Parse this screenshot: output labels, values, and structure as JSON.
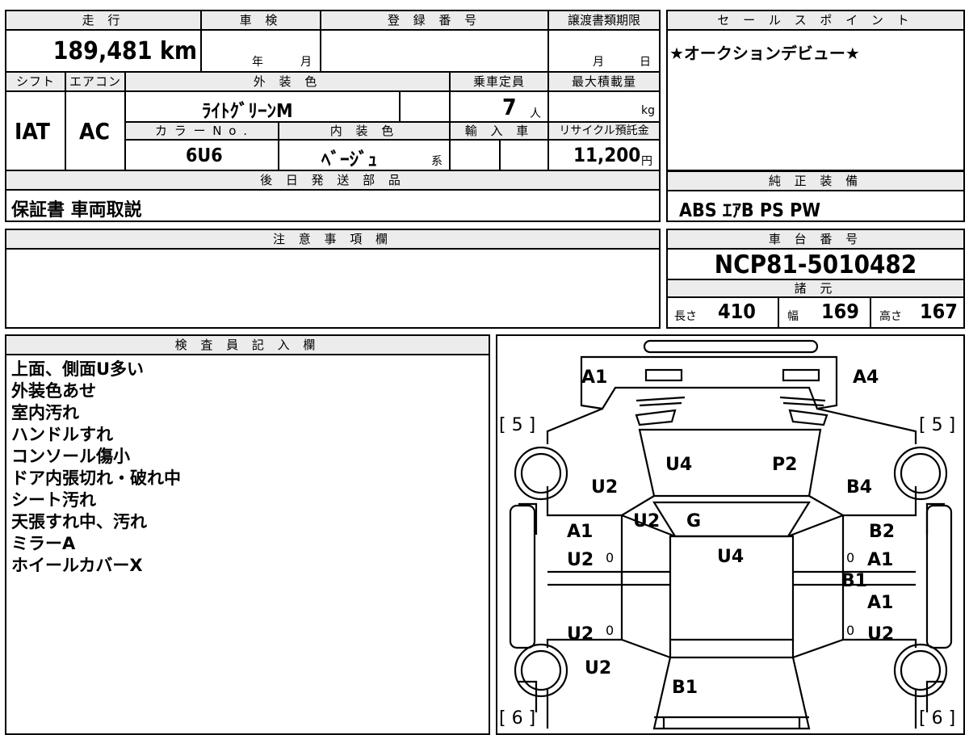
{
  "top_sheet": {
    "mileage_header": "走 行",
    "mileage": "189,481 km",
    "inspection_header": "車 検",
    "inspection_year_unit": "年",
    "inspection_month_unit": "月",
    "registration_header": "登 録 番 号",
    "transfer_header": "譲渡書類期限",
    "transfer_month_unit": "月",
    "transfer_day_unit": "日",
    "shift_header": "シフト",
    "shift": "IAT",
    "ac_header": "エアコン",
    "ac": "AC",
    "exterior_color_header": "外 装 色",
    "exterior_color": "ﾗｲﾄｸﾞﾘｰﾝM",
    "capacity_header": "乗車定員",
    "capacity": "7",
    "capacity_unit": "人",
    "max_load_header": "最大積載量",
    "max_load_unit": "kg",
    "color_no_header": "カ ラ ー N o .",
    "color_no": "6U6",
    "interior_color_header": "内 装 色",
    "interior_color": "ﾍﾞｰｼﾞｭ",
    "interior_color_suffix": "系",
    "import_header": "輸 入 車",
    "recycle_header": "リサイクル預託金",
    "recycle_fee": "11,200",
    "recycle_unit": "円",
    "later_parts_header": "後 日 発 送 部 品",
    "later_parts": "保証書 車両取説"
  },
  "sales_point": {
    "header": "セ ー ル ス ポ イ ン ト",
    "text": "★オークションデビュー★"
  },
  "genuine_equipment": {
    "header": "純 正 装 備",
    "text": "ABS ｴｱB PS PW"
  },
  "caution": {
    "header": "注 意 事 項 欄",
    "text": ""
  },
  "chassis": {
    "header": "車 台 番 号",
    "number": "NCP81-5010482",
    "spec_header": "諸 元",
    "length_label": "長さ",
    "length": "410",
    "width_label": "幅",
    "width": "169",
    "height_label": "高さ",
    "height": "167"
  },
  "inspector_notes": {
    "header": "検 査 員 記 入 欄",
    "lines": [
      "上面、側面U多い",
      "外装色あせ",
      "室内汚れ",
      "ハンドルすれ",
      "コンソール傷小",
      "ドア内張切れ・破れ中",
      "シート汚れ",
      "天張すれ中、汚れ",
      "ミラーA",
      "ホイールカバーX"
    ]
  },
  "diagram": {
    "labels": {
      "front_left_corner": "A1",
      "front_right_corner": "A4",
      "tire_front_left": "[ 5 ]",
      "tire_front_right": "[ 5 ]",
      "tire_rear_left": "[ 6 ]",
      "tire_rear_right": "[ 6 ]",
      "hood_left": "U4",
      "hood_right": "P2",
      "left_fender": "U2",
      "right_fender": "B4",
      "left_a_pillar": "U2",
      "windshield": "G",
      "roof": "U4",
      "left_front_door_1": "A1",
      "left_front_door_2": "U2",
      "left_front_door_mark": "0",
      "left_rear_door": "U2",
      "left_rear_door_mark": "0",
      "left_quarter": "U2",
      "right_front_door_1": "B2",
      "right_front_door_2": "A1",
      "right_front_door_mark": "0",
      "right_center_pillar": "B1",
      "right_rear_door_1": "A1",
      "right_rear_door_2": "U2",
      "right_rear_door_mark": "0",
      "rear_hatch": "B1"
    }
  }
}
